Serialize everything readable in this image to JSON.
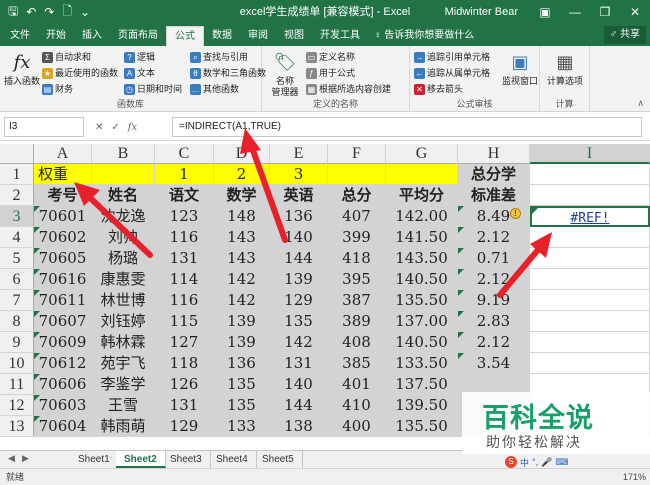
{
  "titlebar": {
    "title": "excel学生成绩单 [兼容模式] - Excel",
    "user": "Midwinter Bear",
    "save_icon": "save-icon",
    "undo_icon": "undo-icon",
    "redo_icon": "redo-icon"
  },
  "tabs": [
    "文件",
    "开始",
    "插入",
    "页面布局",
    "公式",
    "数据",
    "审阅",
    "视图",
    "开发工具"
  ],
  "active_tab": "公式",
  "tellme": "♀ 告诉我你想要做什么",
  "share": "♂ 共享",
  "ribbon": {
    "insert_function": "插入函数",
    "autosum": "自动求和",
    "recent": "最近使用的函数",
    "financial": "财务",
    "logical": "逻辑",
    "text": "文本",
    "datetime": "日期和时间",
    "lookup": "查找与引用",
    "math": "数学和三角函数",
    "other": "其他函数",
    "library_label": "函数库",
    "name_manager": "名称\n管理器",
    "define_name": "定义名称",
    "use_in_formula": "用于公式",
    "create_from_sel": "根据所选内容创建",
    "defined_names_label": "定义的名称",
    "trace_precedents": "追踪引用单元格",
    "trace_dependents": "追踪从属单元格",
    "remove_arrows": "移去箭头",
    "watch_window": "监视窗口",
    "auditing_label": "公式审核",
    "calc_options": "计算选项",
    "calc_label": "计算"
  },
  "formula_bar": {
    "namebox": "I3",
    "cancel": "✕",
    "enter": "✓",
    "fx": "fx",
    "formula": "=INDIRECT(A1,TRUE)"
  },
  "columns": [
    "A",
    "B",
    "C",
    "D",
    "E",
    "F",
    "G",
    "H",
    "I"
  ],
  "selected_column": "I",
  "rows": [
    "1",
    "2",
    "3",
    "4",
    "5",
    "6",
    "7",
    "8",
    "9",
    "10",
    "11",
    "12",
    "13"
  ],
  "selected_row": "3",
  "sheet": {
    "row1": [
      "权重",
      "",
      "1",
      "2",
      "3",
      "",
      "",
      "总分学",
      ""
    ],
    "row2": [
      "考号",
      "姓名",
      "语文",
      "数学",
      "英语",
      "总分",
      "平均分",
      "标准差",
      ""
    ],
    "data": [
      [
        "70601",
        "沈龙逸",
        "123",
        "148",
        "136",
        "407",
        "142.00",
        "8.49",
        "#REF!"
      ],
      [
        "70602",
        "刘帅",
        "116",
        "143",
        "140",
        "399",
        "141.50",
        "2.12",
        ""
      ],
      [
        "70605",
        "杨璐",
        "131",
        "143",
        "144",
        "418",
        "143.50",
        "0.71",
        ""
      ],
      [
        "70616",
        "康惠雯",
        "114",
        "142",
        "139",
        "395",
        "140.50",
        "2.12",
        ""
      ],
      [
        "70611",
        "林世博",
        "116",
        "142",
        "129",
        "387",
        "135.50",
        "9.19",
        ""
      ],
      [
        "70607",
        "刘钰婷",
        "115",
        "139",
        "135",
        "389",
        "137.00",
        "2.83",
        ""
      ],
      [
        "70609",
        "韩林霖",
        "127",
        "139",
        "142",
        "408",
        "140.50",
        "2.12",
        ""
      ],
      [
        "70612",
        "苑宇飞",
        "118",
        "136",
        "131",
        "385",
        "133.50",
        "3.54",
        ""
      ],
      [
        "70606",
        "李鉴学",
        "126",
        "135",
        "140",
        "401",
        "137.50",
        ""
      ],
      [
        "70603",
        "王雪",
        "131",
        "135",
        "144",
        "410",
        "139.50",
        ""
      ],
      [
        "70604",
        "韩雨萌",
        "129",
        "133",
        "138",
        "400",
        "135.50",
        ""
      ]
    ]
  },
  "sheets": [
    "Sheet1",
    "Sheet2",
    "Sheet3",
    "Sheet4",
    "Sheet5"
  ],
  "active_sheet": "Sheet2",
  "status": {
    "left": "就绪",
    "zoom": "171%"
  },
  "watermark": {
    "main": "百科全说",
    "sub": "助你轻松解决"
  },
  "ime": {
    "s": "S",
    "zh": "中",
    "dot": "°,",
    "mic": "🎤",
    "kb": "⌨"
  },
  "colors": {
    "excel_green": "#217346",
    "highlight_yellow": "#ffff00",
    "grey_cell": "#d3d3d3",
    "arrow_red": "#e8202a"
  }
}
